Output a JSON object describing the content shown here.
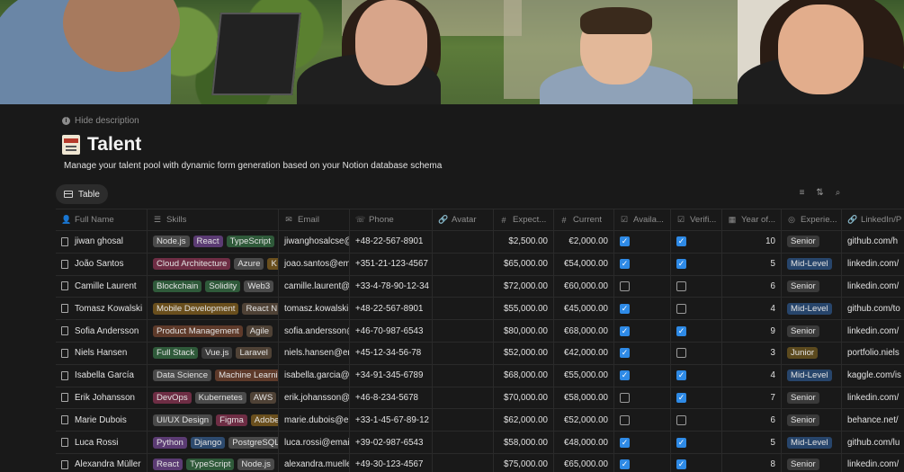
{
  "header": {
    "hide_description": "Hide description",
    "title": "Talent",
    "description": "Manage your talent pool with dynamic form generation based on your Notion database schema"
  },
  "view": {
    "tab_label": "Table"
  },
  "toolbar": {
    "icons": [
      "filter-icon",
      "sort-icon",
      "search-icon"
    ]
  },
  "columns": [
    {
      "label": "Full Name",
      "icon": "person-icon"
    },
    {
      "label": "Skills",
      "icon": "list-icon"
    },
    {
      "label": "Email",
      "icon": "mail-icon"
    },
    {
      "label": "Phone",
      "icon": "phone-icon"
    },
    {
      "label": "Avatar",
      "icon": "link-icon"
    },
    {
      "label": "Expect...",
      "icon": "number-icon"
    },
    {
      "label": "Current",
      "icon": "number-icon"
    },
    {
      "label": "Availa...",
      "icon": "checkbox-icon"
    },
    {
      "label": "Verifi...",
      "icon": "checkbox-icon"
    },
    {
      "label": "Year of...",
      "icon": "calendar-icon"
    },
    {
      "label": "Experie...",
      "icon": "select-icon"
    },
    {
      "label": "LinkedIn/P",
      "icon": "link-icon"
    }
  ],
  "rows": [
    {
      "name": "jiwan ghosal",
      "skills": [
        "Node.js",
        "React",
        "TypeScript"
      ],
      "email": "jiwanghosalcse@",
      "phone": "+48-22-567-8901",
      "expected": "$2,500.00",
      "current": "€2,000.00",
      "available": true,
      "verified": true,
      "years": "10",
      "experience": "Senior",
      "link": "github.com/h"
    },
    {
      "name": "João Santos",
      "skills": [
        "Cloud Architecture",
        "Azure",
        "K"
      ],
      "email": "joao.santos@em",
      "phone": "+351-21-123-4567",
      "expected": "$65,000.00",
      "current": "€54,000.00",
      "available": true,
      "verified": true,
      "years": "5",
      "experience": "Mid-Level",
      "link": "linkedin.com/"
    },
    {
      "name": "Camille Laurent",
      "skills": [
        "Blockchain",
        "Solidity",
        "Web3"
      ],
      "email": "camille.laurent@",
      "phone": "+33-4-78-90-12-34",
      "expected": "$72,000.00",
      "current": "€60,000.00",
      "available": false,
      "verified": false,
      "years": "6",
      "experience": "Senior",
      "link": "linkedin.com/"
    },
    {
      "name": "Tomasz Kowalski",
      "skills": [
        "Mobile Development",
        "React N"
      ],
      "email": "tomasz.kowalski",
      "phone": "+48-22-567-8901",
      "expected": "$55,000.00",
      "current": "€45,000.00",
      "available": true,
      "verified": false,
      "years": "4",
      "experience": "Mid-Level",
      "link": "github.com/to"
    },
    {
      "name": "Sofia Andersson",
      "skills": [
        "Product Management",
        "Agile"
      ],
      "email": "sofia.andersson@",
      "phone": "+46-70-987-6543",
      "expected": "$80,000.00",
      "current": "€68,000.00",
      "available": true,
      "verified": true,
      "years": "9",
      "experience": "Senior",
      "link": "linkedin.com/"
    },
    {
      "name": "Niels Hansen",
      "skills": [
        "Full Stack",
        "Vue.js",
        "Laravel"
      ],
      "email": "niels.hansen@em",
      "phone": "+45-12-34-56-78",
      "expected": "$52,000.00",
      "current": "€42,000.00",
      "available": true,
      "verified": false,
      "years": "3",
      "experience": "Junior",
      "link": "portfolio.niels"
    },
    {
      "name": "Isabella García",
      "skills": [
        "Data Science",
        "Machine Learni"
      ],
      "email": "isabella.garcia@",
      "phone": "+34-91-345-6789",
      "expected": "$68,000.00",
      "current": "€55,000.00",
      "available": true,
      "verified": true,
      "years": "4",
      "experience": "Mid-Level",
      "link": "kaggle.com/is"
    },
    {
      "name": "Erik Johansson",
      "skills": [
        "DevOps",
        "Kubernetes",
        "AWS"
      ],
      "email": "erik.johansson@",
      "phone": "+46-8-234-5678",
      "expected": "$70,000.00",
      "current": "€58,000.00",
      "available": false,
      "verified": true,
      "years": "7",
      "experience": "Senior",
      "link": "linkedin.com/"
    },
    {
      "name": "Marie Dubois",
      "skills": [
        "UI/UX Design",
        "Figma",
        "Adobe"
      ],
      "email": "marie.dubois@em",
      "phone": "+33-1-45-67-89-12",
      "expected": "$62,000.00",
      "current": "€52,000.00",
      "available": false,
      "verified": false,
      "years": "6",
      "experience": "Senior",
      "link": "behance.net/"
    },
    {
      "name": "Luca Rossi",
      "skills": [
        "Python",
        "Django",
        "PostgreSQL"
      ],
      "email": "luca.rossi@email",
      "phone": "+39-02-987-6543",
      "expected": "$58,000.00",
      "current": "€48,000.00",
      "available": true,
      "verified": true,
      "years": "5",
      "experience": "Mid-Level",
      "link": "github.com/lu"
    },
    {
      "name": "Alexandra Müller",
      "skills": [
        "React",
        "TypeScript",
        "Node.js"
      ],
      "email": "alexandra.muelle",
      "phone": "+49-30-123-4567",
      "expected": "$75,000.00",
      "current": "€65,000.00",
      "available": true,
      "verified": true,
      "years": "8",
      "experience": "Senior",
      "link": "linkedin.com/"
    }
  ],
  "tag_colors": {
    "Node.js": "#4a4a4a",
    "React": "#5b3b73",
    "TypeScript": "#2f5a3a",
    "Cloud Architecture": "#6e2d44",
    "Azure": "#4a4a4a",
    "K": "#6a4f1d",
    "Blockchain": "#2f5a3a",
    "Solidity": "#2f5a3a",
    "Web3": "#4a4a4a",
    "Mobile Development": "#6a4f1d",
    "React N": "#4f4236",
    "Product Management": "#5e3a2a",
    "Agile": "#4f4236",
    "Full Stack": "#2f5a3a",
    "Vue.js": "#3a3a3a",
    "Laravel": "#4f4236",
    "Data Science": "#4a4a4a",
    "Machine Learni": "#5e3a2a",
    "DevOps": "#6e2d44",
    "Kubernetes": "#4a4a4a",
    "AWS": "#4f4236",
    "UI/UX Design": "#4a4a4a",
    "Figma": "#6e2d44",
    "Adobe": "#6a4f1d",
    "Python": "#5b3b73",
    "Django": "#2d4a6e",
    "PostgreSQL": "#4a4a4a"
  },
  "experience_colors": {
    "Senior": "#3a3a3a",
    "Mid-Level": "#27456b",
    "Junior": "#5c4a1e"
  }
}
